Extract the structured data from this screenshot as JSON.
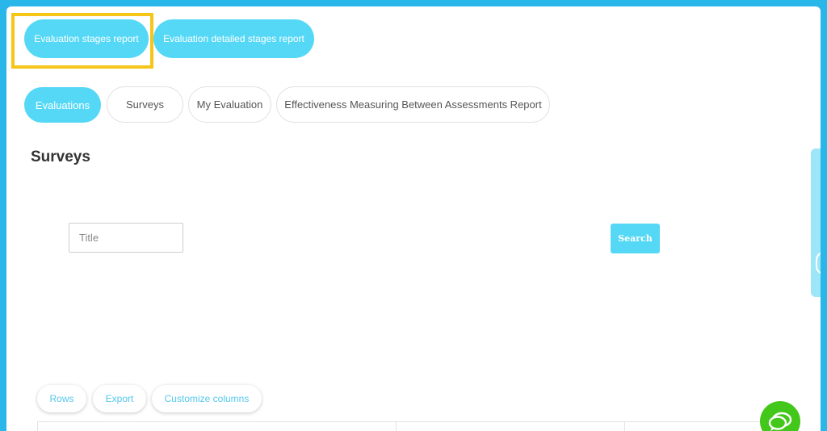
{
  "report_tabs": [
    {
      "label": "Evaluation stages report"
    },
    {
      "label": "Evaluation detailed stages report"
    }
  ],
  "nav_tabs": [
    {
      "label": "Evaluations",
      "active": true
    },
    {
      "label": "Surveys",
      "active": false
    },
    {
      "label": "My Evaluation",
      "active": false
    },
    {
      "label": "Effectiveness Measuring Between Assessments Report",
      "active": false
    }
  ],
  "page": {
    "title": "Surveys"
  },
  "filters": {
    "title_placeholder": "Title",
    "title_value": "",
    "search_label": "Search"
  },
  "toolbar": {
    "rows_label": "Rows",
    "export_label": "Export",
    "customize_label": "Customize columns"
  },
  "colors": {
    "accent": "#55d8f6",
    "frame": "#29b6e8",
    "highlight": "#f5c518",
    "chat": "#44c71b"
  },
  "icons": {
    "chat": "chat-bubble-icon",
    "side_tab": "side-drawer-handle-icon"
  }
}
